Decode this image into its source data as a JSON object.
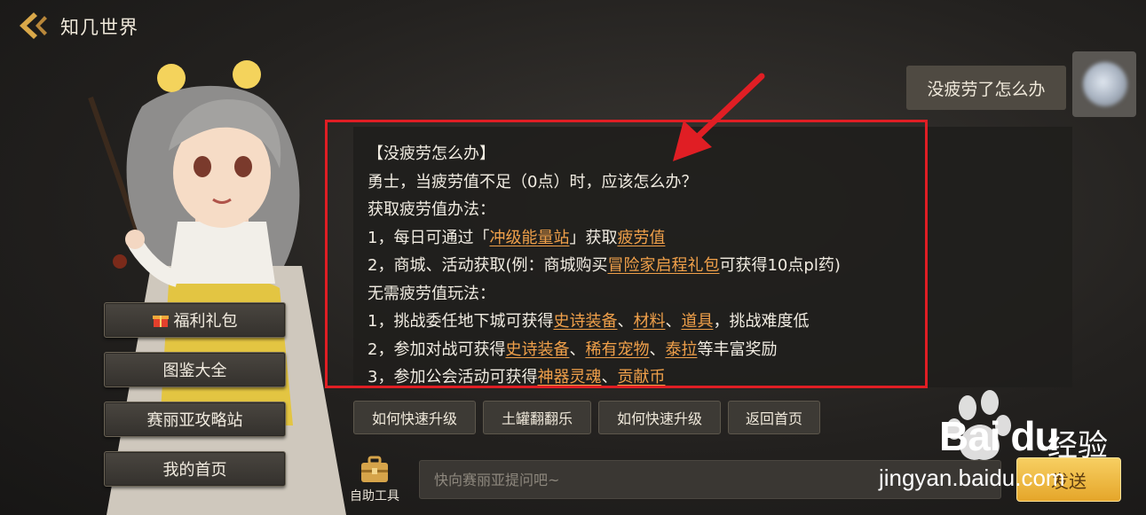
{
  "header": {
    "title": "知几世界"
  },
  "sidebar": {
    "items": [
      {
        "label": "福利礼包",
        "icon": "gift-icon"
      },
      {
        "label": "图鉴大全"
      },
      {
        "label": "赛丽亚攻略站"
      },
      {
        "label": "我的首页"
      }
    ]
  },
  "chat": {
    "user_message": "没疲劳了怎么办",
    "answer": {
      "title": "【没疲劳怎么办】",
      "intro": "勇士，当疲劳值不足（0点）时，应该怎么办？",
      "section1_heading": "获取疲劳值办法：",
      "item1_prefix": "1，每日可通过「",
      "item1_link1": "冲级能量站",
      "item1_mid": "」获取",
      "item1_link2": "疲劳值",
      "item2_prefix": "2，商城、活动获取(例：商城购买",
      "item2_link": "冒险家启程礼包",
      "item2_suffix": "可获得10点pl药)",
      "section2_heading": "无需疲劳值玩法：",
      "item3_prefix": "1，挑战委任地下城可获得",
      "item3_link1": "史诗装备",
      "item3_sep1": "、",
      "item3_link2": "材料",
      "item3_sep2": "、",
      "item3_link3": "道具",
      "item3_suffix": "，挑战难度低",
      "item4_prefix": "2，参加对战可获得",
      "item4_link1": "史诗装备",
      "item4_sep1": "、",
      "item4_link2": "稀有宠物",
      "item4_sep2": "、",
      "item4_link3": "泰拉",
      "item4_suffix": "等丰富奖励",
      "item5_prefix": "3，参加公会活动可获得",
      "item5_link1": "神器灵魂",
      "item5_sep": "、",
      "item5_link2": "贡献币"
    }
  },
  "quick_replies": [
    {
      "label": "如何快速升级"
    },
    {
      "label": "土罐翻翻乐"
    },
    {
      "label": "如何快速升级"
    },
    {
      "label": "返回首页"
    }
  ],
  "bottom_bar": {
    "toolbox_label": "自助工具",
    "input_placeholder": "快向赛丽亚提问吧~",
    "send_label": "发送"
  },
  "watermark": {
    "brand": "Bai du",
    "cn": "经验",
    "url": "jingyan.baidu.com"
  },
  "colors": {
    "link": "#f0a04a",
    "highlight": "#e01e24",
    "send_button": "#f0b840"
  }
}
